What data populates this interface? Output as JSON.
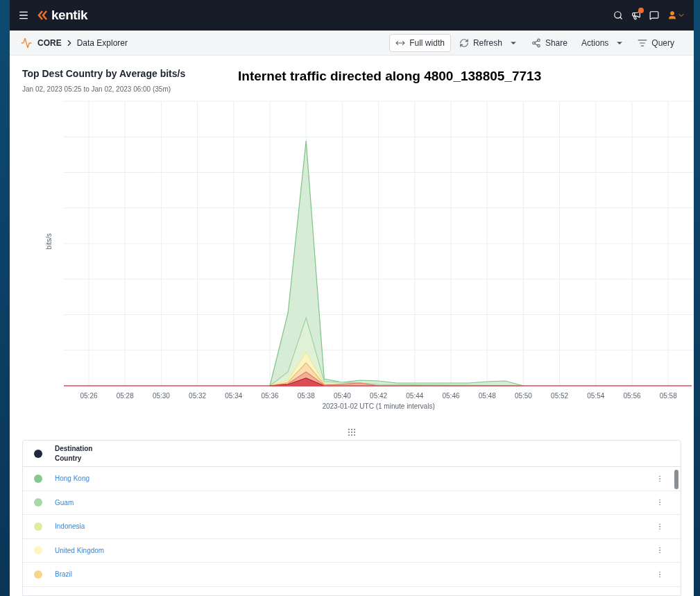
{
  "topbar": {
    "logo": "kentik"
  },
  "breadcrumb": {
    "module": "CORE",
    "page": "Data Explorer"
  },
  "toolbar": [
    {
      "label": "Full width",
      "kind": "outlined",
      "dropdown": false
    },
    {
      "label": "Refresh",
      "kind": "plain",
      "dropdown": true
    },
    {
      "label": "Share",
      "kind": "plain",
      "dropdown": false
    },
    {
      "label": "Actions",
      "kind": "plain",
      "dropdown": true
    },
    {
      "label": "Query",
      "kind": "plain",
      "dropdown": false
    }
  ],
  "panel": {
    "title": "Top Dest Country by Average bits/s",
    "subtitle": "Jan 02, 2023 05:25 to Jan 02, 2023 06:00 (35m)",
    "overlay_title": "Internet traffic directed along 4800_138805_7713"
  },
  "chart": {
    "ylabel": "bits/s",
    "xlabel": "2023-01-02 UTC (1 minute intervals)",
    "xticks": [
      "05:26",
      "05:28",
      "05:30",
      "05:32",
      "05:34",
      "05:36",
      "05:38",
      "05:40",
      "05:42",
      "05:44",
      "05:46",
      "05:48",
      "05:50",
      "05:52",
      "05:54",
      "05:56",
      "05:58"
    ]
  },
  "table": {
    "header": {
      "label": "Destination Country",
      "color": "#1e2a3b"
    },
    "rows": [
      {
        "name": "Hong Kong",
        "color": "#86c98f"
      },
      {
        "name": "Guam",
        "color": "#a9d8a8"
      },
      {
        "name": "Indonesia",
        "color": "#dfeda0"
      },
      {
        "name": "United Kingdom",
        "color": "#fcf7c0"
      },
      {
        "name": "Brazil",
        "color": "#f8d58f"
      }
    ]
  }
}
